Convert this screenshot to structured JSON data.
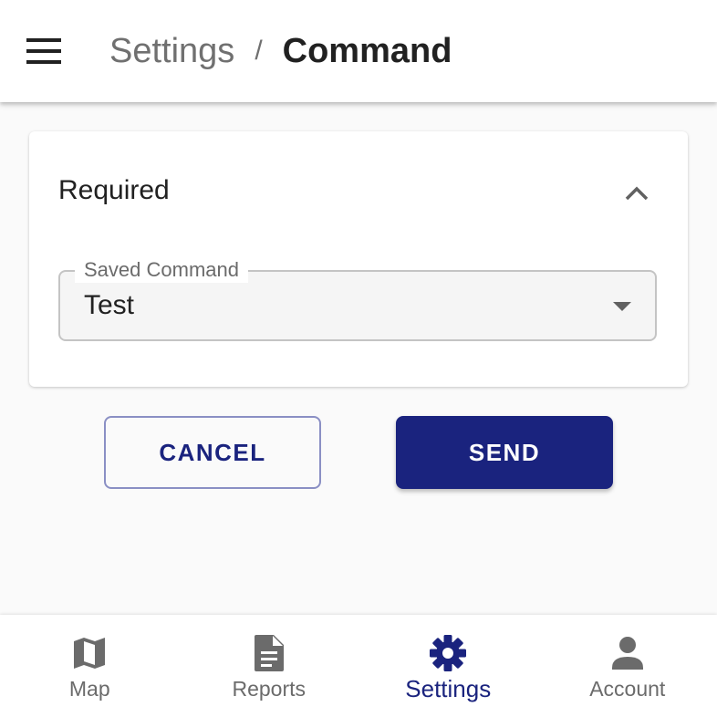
{
  "header": {
    "menu_icon": "hamburger-menu-icon",
    "breadcrumb_parent": "Settings",
    "breadcrumb_separator": "/",
    "breadcrumb_current": "Command"
  },
  "card": {
    "title": "Required",
    "collapse_icon": "chevron-up-icon",
    "select": {
      "label": "Saved Command",
      "value": "Test",
      "dropdown_icon": "arrow-drop-down-icon"
    }
  },
  "actions": {
    "cancel_label": "CANCEL",
    "send_label": "SEND"
  },
  "bottom_nav": {
    "items": [
      {
        "label": "Map",
        "icon": "map-icon",
        "active": false
      },
      {
        "label": "Reports",
        "icon": "document-icon",
        "active": false
      },
      {
        "label": "Settings",
        "icon": "gear-icon",
        "active": true
      },
      {
        "label": "Account",
        "icon": "person-icon",
        "active": false
      }
    ]
  },
  "colors": {
    "primary": "#1a237e",
    "inactive": "#6b6b6b",
    "background": "#fafafa"
  }
}
